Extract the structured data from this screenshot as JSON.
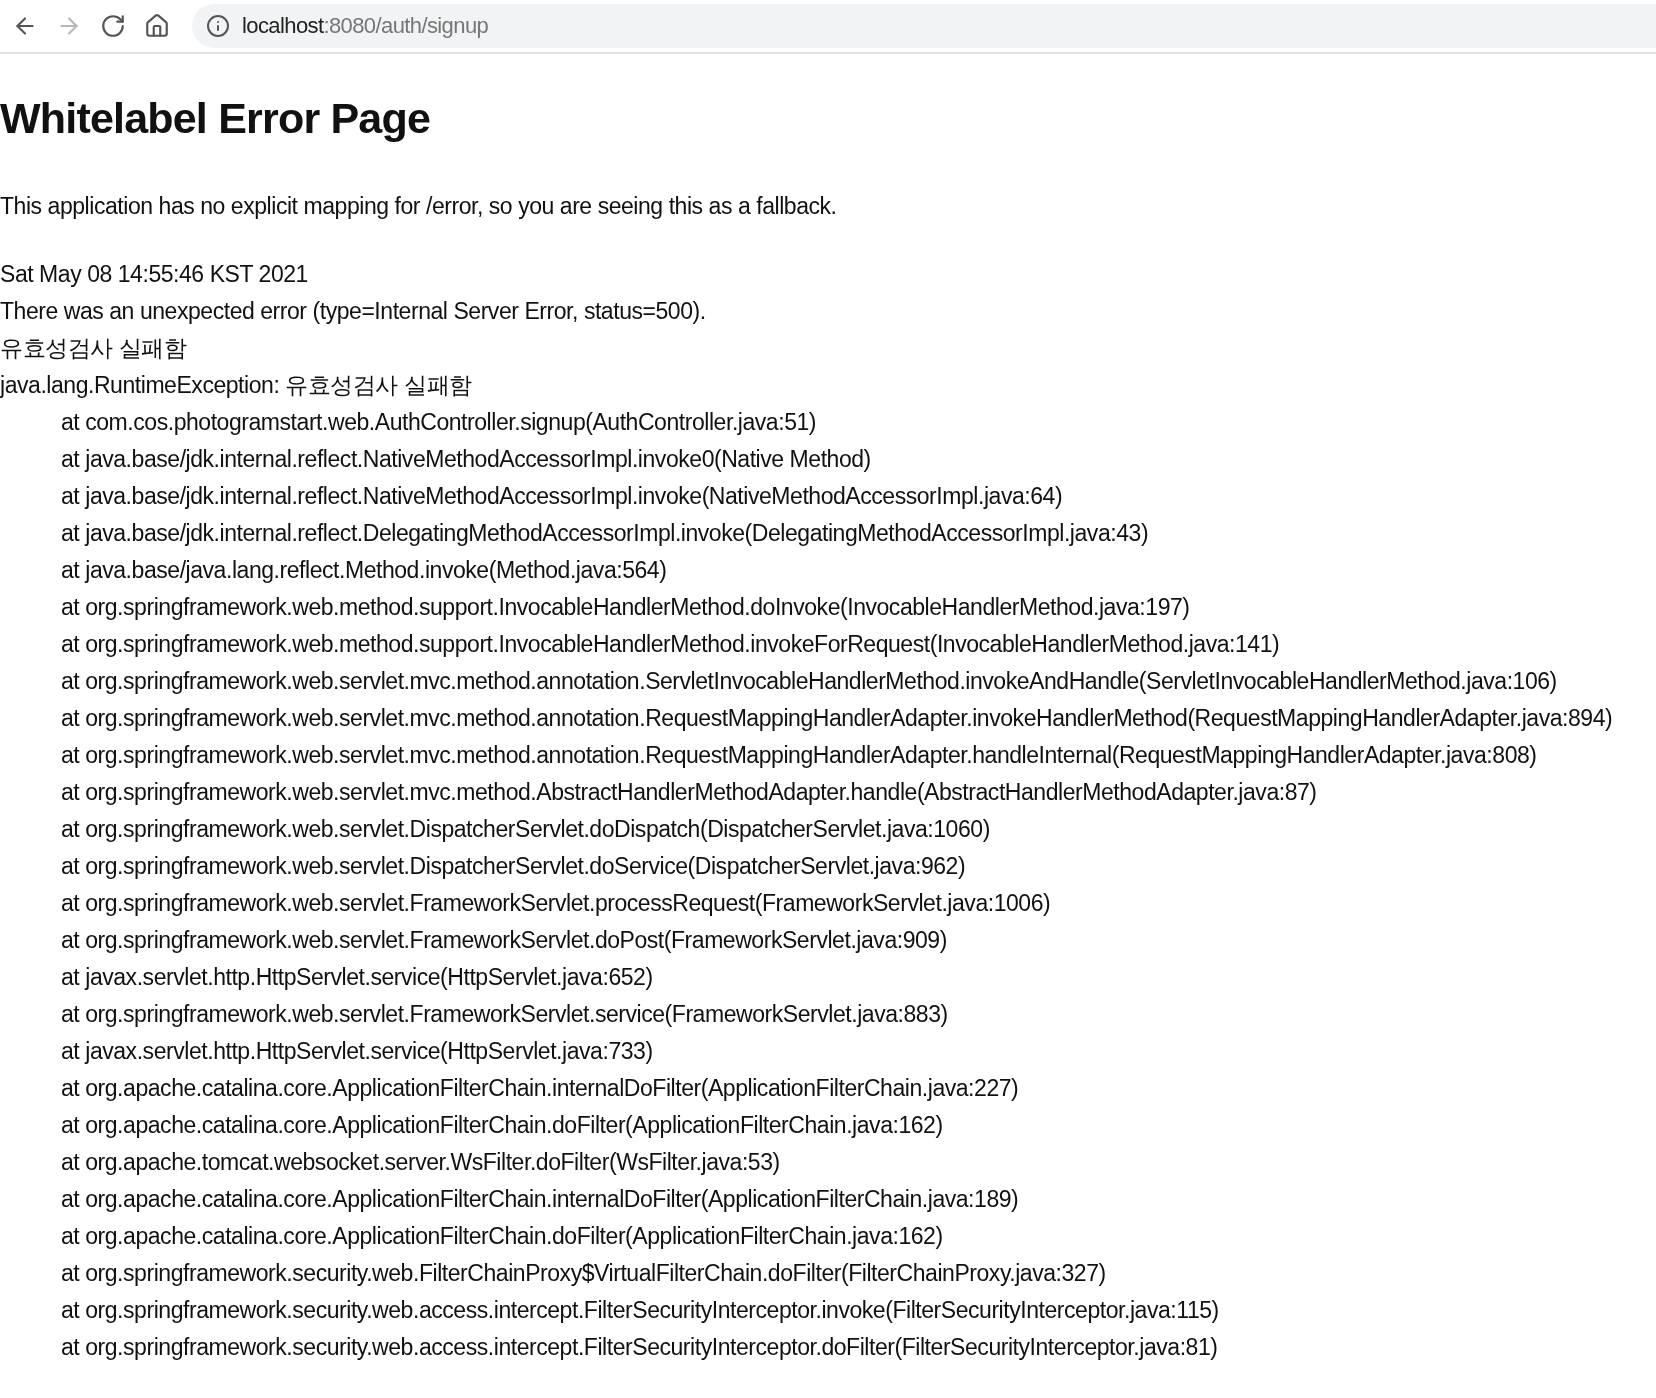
{
  "toolbar": {
    "nav_buttons": [
      {
        "kind": "back",
        "disabled": false
      },
      {
        "kind": "forward",
        "disabled": true
      },
      {
        "kind": "reload",
        "disabled": false
      },
      {
        "kind": "home",
        "disabled": false
      }
    ],
    "address": {
      "host": "localhost",
      "path": ":8080/auth/signup"
    }
  },
  "page": {
    "title": "Whitelabel Error Page",
    "description": "This application has no explicit mapping for /error, so you are seeing this as a fallback.",
    "timestamp": "Sat May 08 14:55:46 KST 2021",
    "error_line": "There was an unexpected error (type=Internal Server Error, status=500).",
    "message": "유효성검사 실패함",
    "exception": "java.lang.RuntimeException: 유효성검사 실패함",
    "stack_trace": [
      "at com.cos.photogramstart.web.AuthController.signup(AuthController.java:51)",
      "at java.base/jdk.internal.reflect.NativeMethodAccessorImpl.invoke0(Native Method)",
      "at java.base/jdk.internal.reflect.NativeMethodAccessorImpl.invoke(NativeMethodAccessorImpl.java:64)",
      "at java.base/jdk.internal.reflect.DelegatingMethodAccessorImpl.invoke(DelegatingMethodAccessorImpl.java:43)",
      "at java.base/java.lang.reflect.Method.invoke(Method.java:564)",
      "at org.springframework.web.method.support.InvocableHandlerMethod.doInvoke(InvocableHandlerMethod.java:197)",
      "at org.springframework.web.method.support.InvocableHandlerMethod.invokeForRequest(InvocableHandlerMethod.java:141)",
      "at org.springframework.web.servlet.mvc.method.annotation.ServletInvocableHandlerMethod.invokeAndHandle(ServletInvocableHandlerMethod.java:106)",
      "at org.springframework.web.servlet.mvc.method.annotation.RequestMappingHandlerAdapter.invokeHandlerMethod(RequestMappingHandlerAdapter.java:894)",
      "at org.springframework.web.servlet.mvc.method.annotation.RequestMappingHandlerAdapter.handleInternal(RequestMappingHandlerAdapter.java:808)",
      "at org.springframework.web.servlet.mvc.method.AbstractHandlerMethodAdapter.handle(AbstractHandlerMethodAdapter.java:87)",
      "at org.springframework.web.servlet.DispatcherServlet.doDispatch(DispatcherServlet.java:1060)",
      "at org.springframework.web.servlet.DispatcherServlet.doService(DispatcherServlet.java:962)",
      "at org.springframework.web.servlet.FrameworkServlet.processRequest(FrameworkServlet.java:1006)",
      "at org.springframework.web.servlet.FrameworkServlet.doPost(FrameworkServlet.java:909)",
      "at javax.servlet.http.HttpServlet.service(HttpServlet.java:652)",
      "at org.springframework.web.servlet.FrameworkServlet.service(FrameworkServlet.java:883)",
      "at javax.servlet.http.HttpServlet.service(HttpServlet.java:733)",
      "at org.apache.catalina.core.ApplicationFilterChain.internalDoFilter(ApplicationFilterChain.java:227)",
      "at org.apache.catalina.core.ApplicationFilterChain.doFilter(ApplicationFilterChain.java:162)",
      "at org.apache.tomcat.websocket.server.WsFilter.doFilter(WsFilter.java:53)",
      "at org.apache.catalina.core.ApplicationFilterChain.internalDoFilter(ApplicationFilterChain.java:189)",
      "at org.apache.catalina.core.ApplicationFilterChain.doFilter(ApplicationFilterChain.java:162)",
      "at org.springframework.security.web.FilterChainProxy$VirtualFilterChain.doFilter(FilterChainProxy.java:327)",
      "at org.springframework.security.web.access.intercept.FilterSecurityInterceptor.invoke(FilterSecurityInterceptor.java:115)",
      "at org.springframework.security.web.access.intercept.FilterSecurityInterceptor.doFilter(FilterSecurityInterceptor.java:81)"
    ]
  }
}
